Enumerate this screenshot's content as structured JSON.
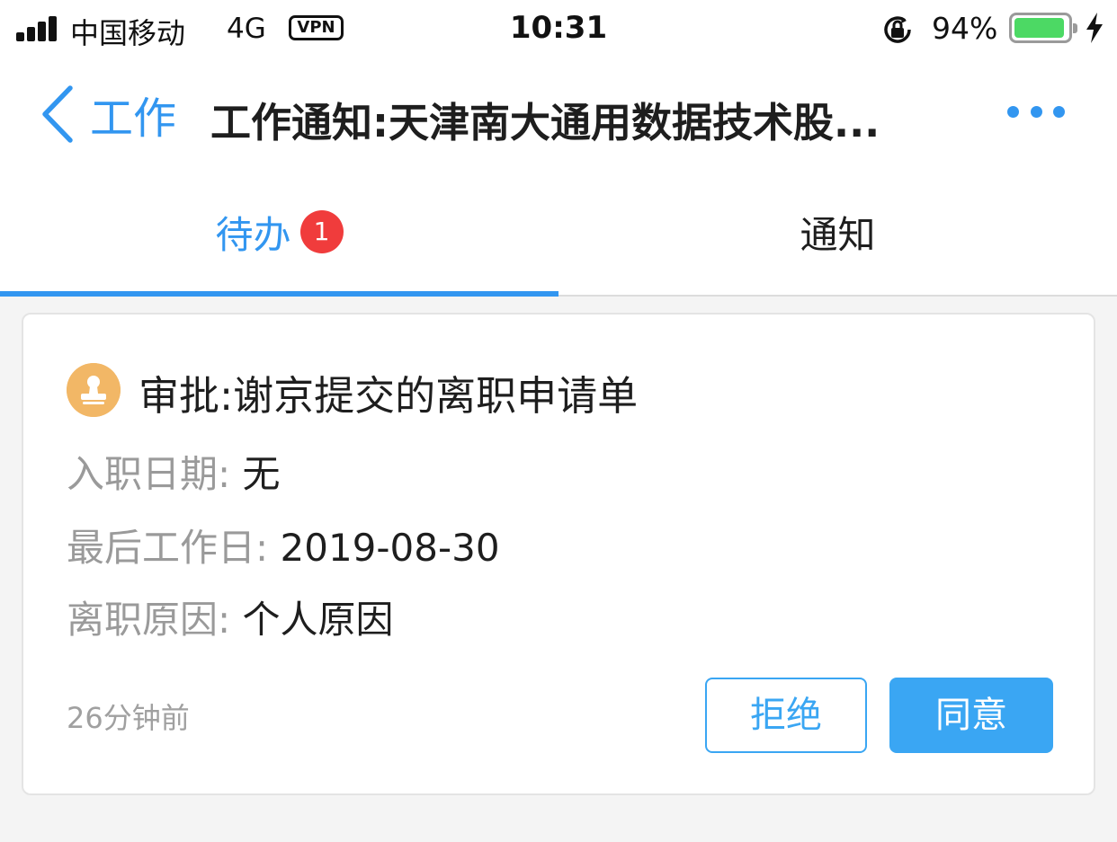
{
  "status_bar": {
    "carrier": "中国移动",
    "network": "4G",
    "vpn": "VPN",
    "time": "10:31",
    "battery_percent": "94%",
    "battery_level": 0.94,
    "colors": {
      "battery_fill": "#4cd964"
    }
  },
  "nav": {
    "back_label": "工作",
    "title": "工作通知:天津南大通用数据技术股...",
    "more_icon": "more-dots-icon"
  },
  "tabs": [
    {
      "label": "待办",
      "badge": "1",
      "active": true
    },
    {
      "label": "通知",
      "active": false
    }
  ],
  "card": {
    "avatar_icon": "stamp-icon",
    "title": "审批:谢京提交的离职申请单",
    "fields": [
      {
        "key": "入职日期:",
        "value": "无"
      },
      {
        "key": "最后工作日:",
        "value": "2019-08-30"
      },
      {
        "key": "离职原因:",
        "value": "个人原因"
      }
    ],
    "time_ago": "26分钟前",
    "reject_label": "拒绝",
    "agree_label": "同意"
  },
  "colors": {
    "accent": "#3296f0",
    "button": "#3aa6f3",
    "badge": "#f03c3c",
    "avatar": "#f2b766"
  }
}
